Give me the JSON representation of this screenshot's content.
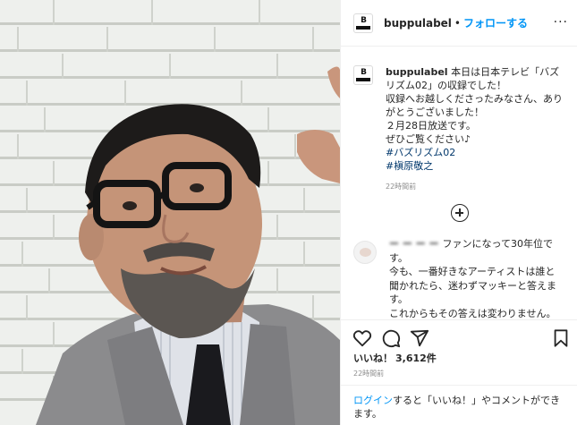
{
  "post": {
    "username": "buppulabel",
    "separator": "•",
    "follow_label": "フォローする",
    "more_label": "···",
    "avatar_text": "B",
    "caption_lines": [
      "本日は日本テレビ「バズ",
      "リズム02」の収録でした！",
      "収録へお越しくださったみなさん、あり",
      "がとうございました！",
      "２月28日放送です。",
      "ぜひご覧ください♪"
    ],
    "hashtags": [
      "#バズリズム02",
      "#槇原敬之"
    ],
    "caption_time": "22時間前"
  },
  "comment": {
    "username": "ー ー ー ー",
    "lines": [
      "ファンになって30年位で",
      "す。",
      "今も、一番好きなアーティストは誰と",
      "聞かれたら、迷わずマッキーと答えま",
      "す。",
      "これからもその答えは変わりません。"
    ]
  },
  "actions": {
    "icons": [
      "heart-icon",
      "comment-icon",
      "share-icon",
      "bookmark-icon"
    ]
  },
  "likes": {
    "label": "いいね！",
    "count": "3,612件"
  },
  "posted_time": "22時間前",
  "login_prompt": {
    "link": "ログイン",
    "text": "すると「いいね！」やコメントができ",
    "text2": "ます。"
  },
  "colors": {
    "accent": "#0095f6",
    "hashtag": "#00376b",
    "text": "#262626",
    "muted": "#8e8e8e"
  }
}
